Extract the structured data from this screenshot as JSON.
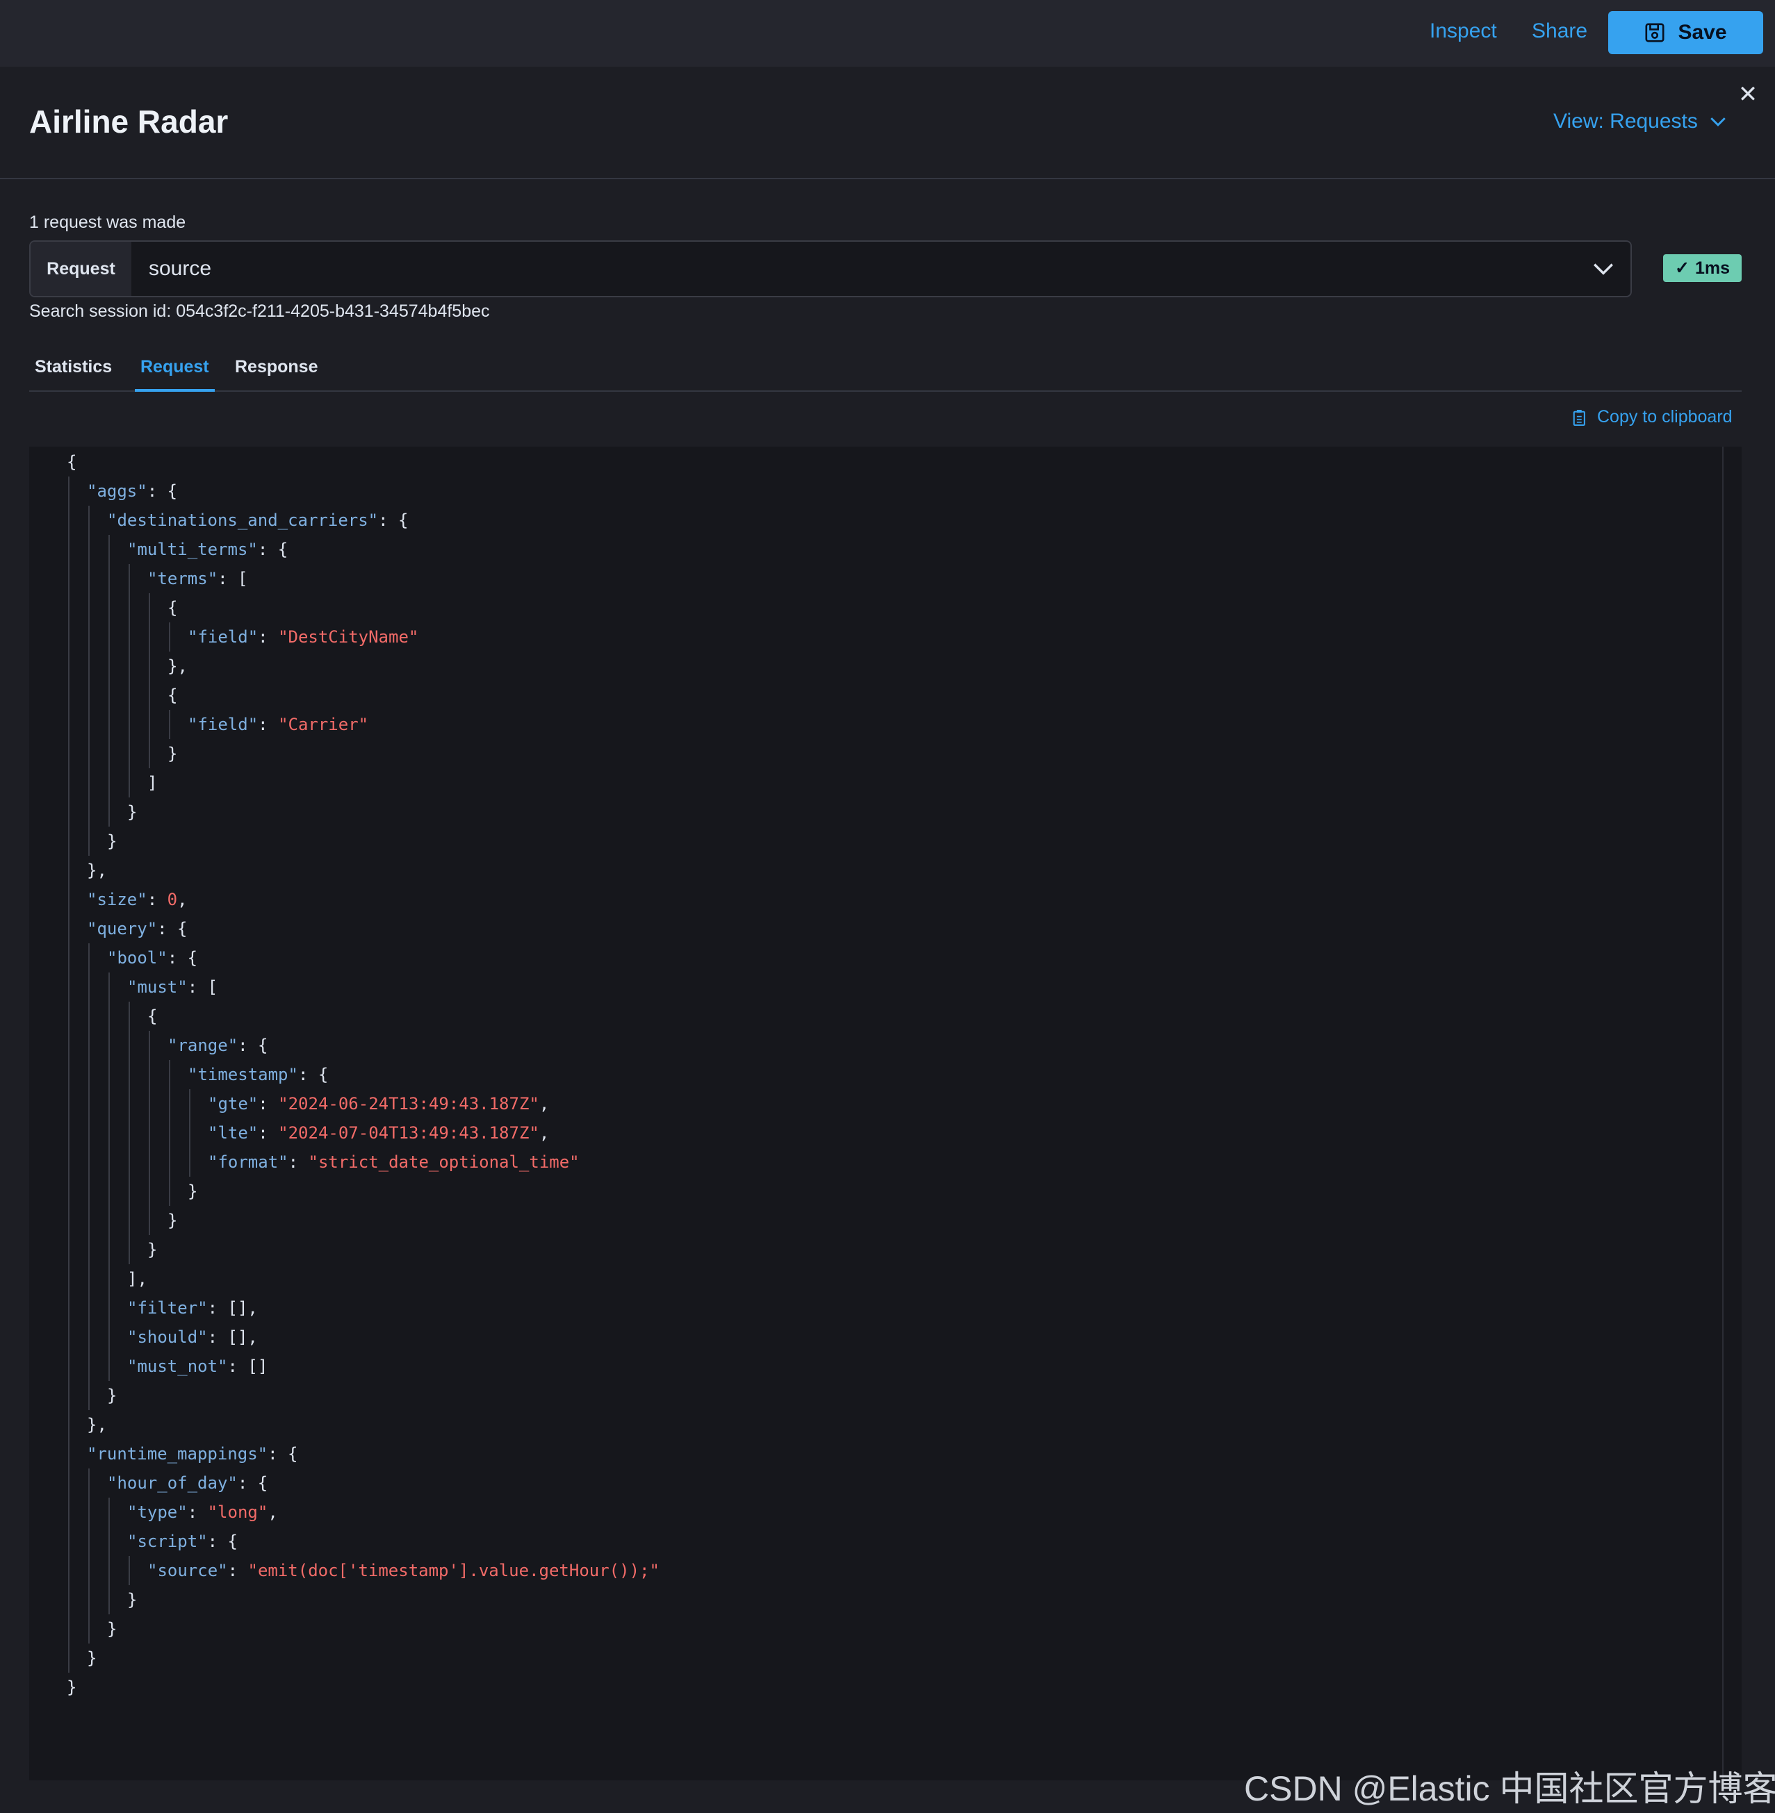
{
  "topbar": {
    "inspect_label": "Inspect",
    "share_label": "Share",
    "save_label": "Save"
  },
  "flyout": {
    "title": "Airline Radar",
    "view_menu_label": "View: Requests",
    "request_count_text": "1 request was made",
    "request_select": {
      "prepend": "Request",
      "value": "source"
    },
    "timing_badge": "1ms",
    "session_id_text": "Search session id: 054c3f2c-f211-4205-b431-34574b4f5bec",
    "tabs": [
      {
        "label": "Statistics",
        "active": false
      },
      {
        "label": "Request",
        "active": true
      },
      {
        "label": "Response",
        "active": false
      }
    ],
    "copy_label": "Copy to clipboard"
  },
  "code": {
    "lines": [
      {
        "i": 0,
        "p": [
          {
            "t": "{"
          }
        ]
      },
      {
        "i": 1,
        "p": [
          {
            "c": "k",
            "t": "\"aggs\""
          },
          {
            "t": ": {"
          }
        ]
      },
      {
        "i": 2,
        "p": [
          {
            "c": "k",
            "t": "\"destinations_and_carriers\""
          },
          {
            "t": ": {"
          }
        ]
      },
      {
        "i": 3,
        "p": [
          {
            "c": "k",
            "t": "\"multi_terms\""
          },
          {
            "t": ": {"
          }
        ]
      },
      {
        "i": 4,
        "p": [
          {
            "c": "k",
            "t": "\"terms\""
          },
          {
            "t": ": ["
          }
        ]
      },
      {
        "i": 5,
        "p": [
          {
            "t": "{"
          }
        ]
      },
      {
        "i": 6,
        "p": [
          {
            "c": "k",
            "t": "\"field\""
          },
          {
            "t": ": "
          },
          {
            "c": "s",
            "t": "\"DestCityName\""
          }
        ]
      },
      {
        "i": 5,
        "p": [
          {
            "t": "},"
          }
        ]
      },
      {
        "i": 5,
        "p": [
          {
            "t": "{"
          }
        ]
      },
      {
        "i": 6,
        "p": [
          {
            "c": "k",
            "t": "\"field\""
          },
          {
            "t": ": "
          },
          {
            "c": "s",
            "t": "\"Carrier\""
          }
        ]
      },
      {
        "i": 5,
        "p": [
          {
            "t": "}"
          }
        ]
      },
      {
        "i": 4,
        "p": [
          {
            "t": "]"
          }
        ]
      },
      {
        "i": 3,
        "p": [
          {
            "t": "}"
          }
        ]
      },
      {
        "i": 2,
        "p": [
          {
            "t": "}"
          }
        ]
      },
      {
        "i": 1,
        "p": [
          {
            "t": "},"
          }
        ]
      },
      {
        "i": 1,
        "p": [
          {
            "c": "k",
            "t": "\"size\""
          },
          {
            "t": ": "
          },
          {
            "c": "n",
            "t": "0"
          },
          {
            "t": ","
          }
        ]
      },
      {
        "i": 1,
        "p": [
          {
            "c": "k",
            "t": "\"query\""
          },
          {
            "t": ": {"
          }
        ]
      },
      {
        "i": 2,
        "p": [
          {
            "c": "k",
            "t": "\"bool\""
          },
          {
            "t": ": {"
          }
        ]
      },
      {
        "i": 3,
        "p": [
          {
            "c": "k",
            "t": "\"must\""
          },
          {
            "t": ": ["
          }
        ]
      },
      {
        "i": 4,
        "p": [
          {
            "t": "{"
          }
        ]
      },
      {
        "i": 5,
        "p": [
          {
            "c": "k",
            "t": "\"range\""
          },
          {
            "t": ": {"
          }
        ]
      },
      {
        "i": 6,
        "p": [
          {
            "c": "k",
            "t": "\"timestamp\""
          },
          {
            "t": ": {"
          }
        ]
      },
      {
        "i": 7,
        "p": [
          {
            "c": "k",
            "t": "\"gte\""
          },
          {
            "t": ": "
          },
          {
            "c": "s",
            "t": "\"2024-06-24T13:49:43.187Z\""
          },
          {
            "t": ","
          }
        ]
      },
      {
        "i": 7,
        "p": [
          {
            "c": "k",
            "t": "\"lte\""
          },
          {
            "t": ": "
          },
          {
            "c": "s",
            "t": "\"2024-07-04T13:49:43.187Z\""
          },
          {
            "t": ","
          }
        ]
      },
      {
        "i": 7,
        "p": [
          {
            "c": "k",
            "t": "\"format\""
          },
          {
            "t": ": "
          },
          {
            "c": "s",
            "t": "\"strict_date_optional_time\""
          }
        ]
      },
      {
        "i": 6,
        "p": [
          {
            "t": "}"
          }
        ]
      },
      {
        "i": 5,
        "p": [
          {
            "t": "}"
          }
        ]
      },
      {
        "i": 4,
        "p": [
          {
            "t": "}"
          }
        ]
      },
      {
        "i": 3,
        "p": [
          {
            "t": "],"
          }
        ]
      },
      {
        "i": 3,
        "p": [
          {
            "c": "k",
            "t": "\"filter\""
          },
          {
            "t": ": [],"
          }
        ]
      },
      {
        "i": 3,
        "p": [
          {
            "c": "k",
            "t": "\"should\""
          },
          {
            "t": ": [],"
          }
        ]
      },
      {
        "i": 3,
        "p": [
          {
            "c": "k",
            "t": "\"must_not\""
          },
          {
            "t": ": []"
          }
        ]
      },
      {
        "i": 2,
        "p": [
          {
            "t": "}"
          }
        ]
      },
      {
        "i": 1,
        "p": [
          {
            "t": "},"
          }
        ]
      },
      {
        "i": 1,
        "p": [
          {
            "c": "k",
            "t": "\"runtime_mappings\""
          },
          {
            "t": ": {"
          }
        ]
      },
      {
        "i": 2,
        "p": [
          {
            "c": "k",
            "t": "\"hour_of_day\""
          },
          {
            "t": ": {"
          }
        ]
      },
      {
        "i": 3,
        "p": [
          {
            "c": "k",
            "t": "\"type\""
          },
          {
            "t": ": "
          },
          {
            "c": "s",
            "t": "\"long\""
          },
          {
            "t": ","
          }
        ]
      },
      {
        "i": 3,
        "p": [
          {
            "c": "k",
            "t": "\"script\""
          },
          {
            "t": ": {"
          }
        ]
      },
      {
        "i": 4,
        "p": [
          {
            "c": "k",
            "t": "\"source\""
          },
          {
            "t": ": "
          },
          {
            "c": "s",
            "t": "\"emit(doc['timestamp'].value.getHour());\""
          }
        ]
      },
      {
        "i": 3,
        "p": [
          {
            "t": "}"
          }
        ]
      },
      {
        "i": 2,
        "p": [
          {
            "t": "}"
          }
        ]
      },
      {
        "i": 1,
        "p": [
          {
            "t": "}"
          }
        ]
      },
      {
        "i": 0,
        "p": [
          {
            "t": "}"
          }
        ]
      }
    ]
  },
  "watermark": "CSDN @Elastic 中国社区官方博客",
  "colors": {
    "accent": "#36a2ef",
    "success": "#6dccb1",
    "json_key": "#7fb0e0",
    "json_string": "#f26b68",
    "background": "#1d1e24",
    "code_background": "#16171c"
  }
}
